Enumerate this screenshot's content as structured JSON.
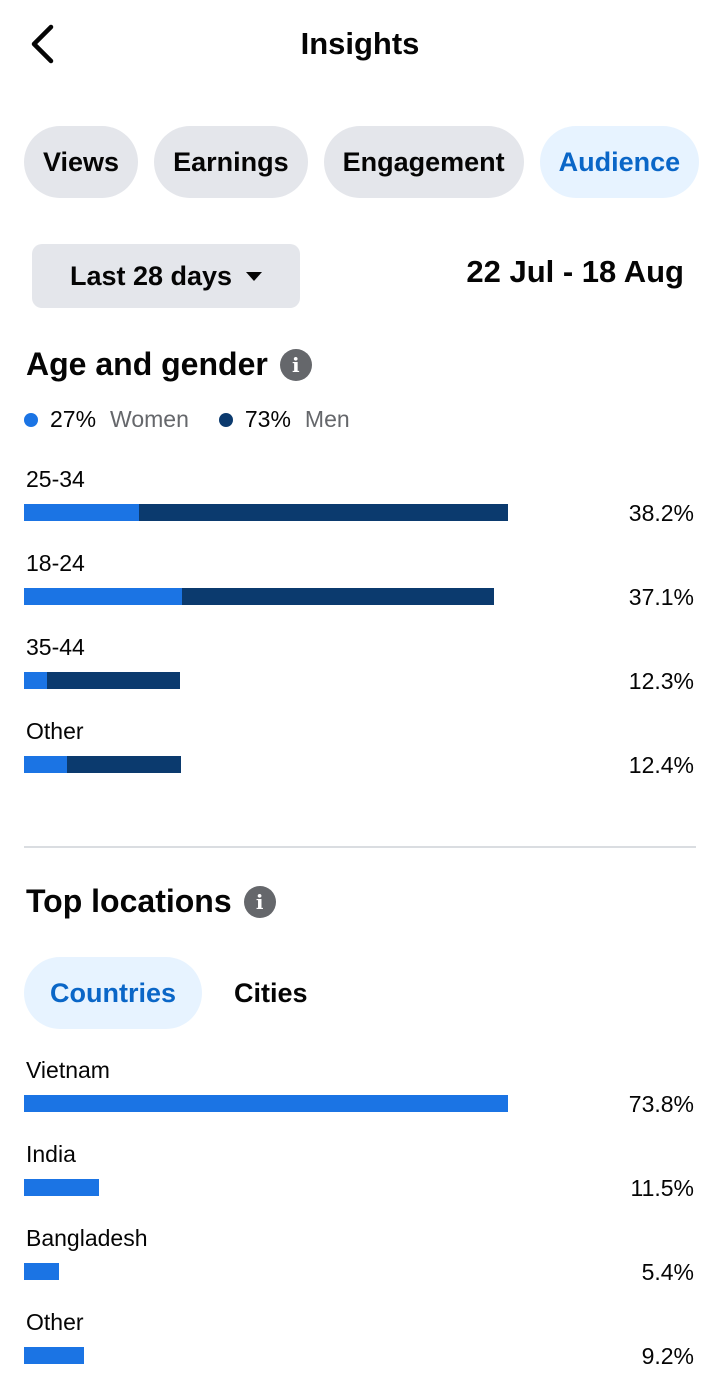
{
  "header": {
    "title": "Insights",
    "back_icon": "chevron-left-icon"
  },
  "tabs": [
    {
      "label": "Views",
      "active": false
    },
    {
      "label": "Earnings",
      "active": false
    },
    {
      "label": "Engagement",
      "active": false
    },
    {
      "label": "Audience",
      "active": true
    }
  ],
  "date_filter": {
    "label": "Last 28 days",
    "range": "22 Jul - 18 Aug"
  },
  "age_gender": {
    "title": "Age and gender",
    "legend": [
      {
        "pct": "27%",
        "label": "Women",
        "color": "#1b74e4"
      },
      {
        "pct": "73%",
        "label": "Men",
        "color": "#0b3a6e"
      }
    ],
    "rows": [
      {
        "label": "25-34",
        "value": "38.2%",
        "share": 0.382,
        "women_fraction": 0.237
      },
      {
        "label": "18-24",
        "value": "37.1%",
        "share": 0.371,
        "women_fraction": 0.336
      },
      {
        "label": "35-44",
        "value": "12.3%",
        "share": 0.123,
        "women_fraction": 0.15
      },
      {
        "label": "Other",
        "value": "12.4%",
        "share": 0.124,
        "women_fraction": 0.274
      }
    ]
  },
  "top_locations": {
    "title": "Top locations",
    "subtabs": [
      {
        "label": "Countries",
        "active": true
      },
      {
        "label": "Cities",
        "active": false
      }
    ],
    "rows": [
      {
        "label": "Vietnam",
        "value": "73.8%",
        "share": 0.738
      },
      {
        "label": "India",
        "value": "11.5%",
        "share": 0.115
      },
      {
        "label": "Bangladesh",
        "value": "5.4%",
        "share": 0.054
      },
      {
        "label": "Other",
        "value": "9.2%",
        "share": 0.092
      }
    ]
  },
  "colors": {
    "accent": "#0a66c7",
    "women": "#1b74e4",
    "men": "#0b3a6e",
    "location_bar": "#1b74e4"
  }
}
